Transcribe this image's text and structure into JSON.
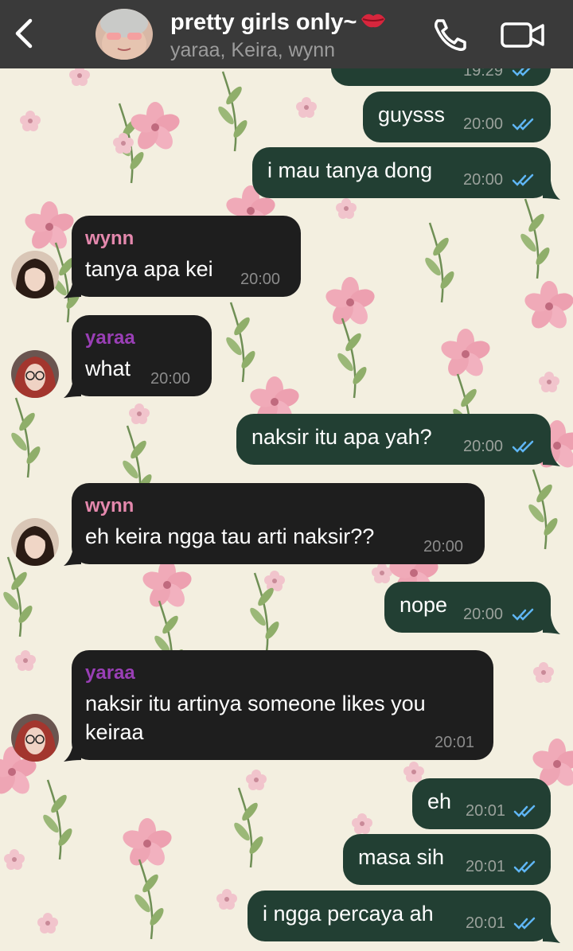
{
  "header": {
    "back_icon": "chevron-left-icon",
    "group_title": "pretty girls only~",
    "title_emoji": "lips-icon",
    "members": "yaraa, Keira, wynn",
    "call_icon": "phone-icon",
    "video_icon": "video-camera-icon"
  },
  "colors": {
    "header_bg": "#3a3a3a",
    "outgoing_bubble": "#223f33",
    "incoming_bubble": "#1e1e1e",
    "wynn_name": "#e488ad",
    "yaraa_name": "#9a3fb6",
    "read_ticks": "#5fb6f5",
    "wallpaper": "#f3efe0"
  },
  "messages": [
    {
      "dir": "out",
      "text": "guysss",
      "time": "20:00",
      "read": true
    },
    {
      "dir": "out",
      "text": "i mau tanya dong",
      "time": "20:00",
      "read": true
    },
    {
      "dir": "in",
      "sender": "wynn",
      "text": "tanya apa kei",
      "time": "20:00"
    },
    {
      "dir": "in",
      "sender": "yaraa",
      "text": "what",
      "time": "20:00"
    },
    {
      "dir": "out",
      "text": "naksir itu apa yah?",
      "time": "20:00",
      "read": true
    },
    {
      "dir": "in",
      "sender": "wynn",
      "text": "eh keira ngga tau arti naksir??",
      "time": "20:00"
    },
    {
      "dir": "out",
      "text": "nope",
      "time": "20:00",
      "read": true
    },
    {
      "dir": "in",
      "sender": "yaraa",
      "text_line1": "naksir itu artinya someone likes you",
      "text_line2": "keiraa",
      "time": "20:01"
    },
    {
      "dir": "out",
      "text": "eh",
      "time": "20:01",
      "read": true
    },
    {
      "dir": "out",
      "text": "masa sih",
      "time": "20:01",
      "read": true
    },
    {
      "dir": "out",
      "text": "i ngga percaya ah",
      "time": "20:01",
      "read": true
    }
  ],
  "partial_top_time": "19:29"
}
